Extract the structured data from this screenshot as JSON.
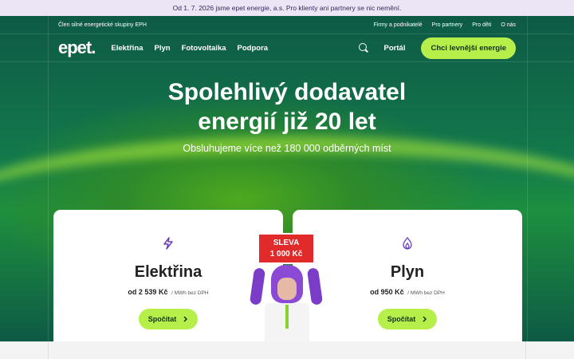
{
  "notice": {
    "text": "Od 1. 7. 2026 jsme epet energie, a.s. Pro klienty ani partnery se nic nemění."
  },
  "topbar": {
    "group_text": "Člen silné energetické skupiny EPH",
    "links": [
      "Firmy a podnikatelé",
      "Pro partnery",
      "Pro děti",
      "O nás"
    ]
  },
  "nav": {
    "logo": "epet.",
    "links": [
      "Elektřina",
      "Plyn",
      "Fotovoltaika",
      "Podpora"
    ],
    "portal": "Portál",
    "cta": "Chci levnější energie",
    "search_icon": "search-icon"
  },
  "hero": {
    "title_line1": "Spolehlivý dodavatel",
    "title_line2": "energií již 20 let",
    "subtitle": "Obsluhujeme více než 180 000 odběrných míst"
  },
  "cards": [
    {
      "icon": "lightning-icon",
      "title": "Elektřina",
      "price": "od 2 539 Kč",
      "unit": "/ MWh bez DPH",
      "button": "Spočítat"
    },
    {
      "icon": "flame-icon",
      "title": "Plyn",
      "price": "od 950 Kč",
      "unit": "/ MWh bez DPH",
      "button": "Spočítat"
    }
  ],
  "mascot": {
    "sign_line1": "SLEVA",
    "sign_line2": "1 000 Kč"
  },
  "colors": {
    "accent": "#b7ef4a",
    "brand_green": "#137a4c",
    "sign_red": "#e12b2b"
  }
}
